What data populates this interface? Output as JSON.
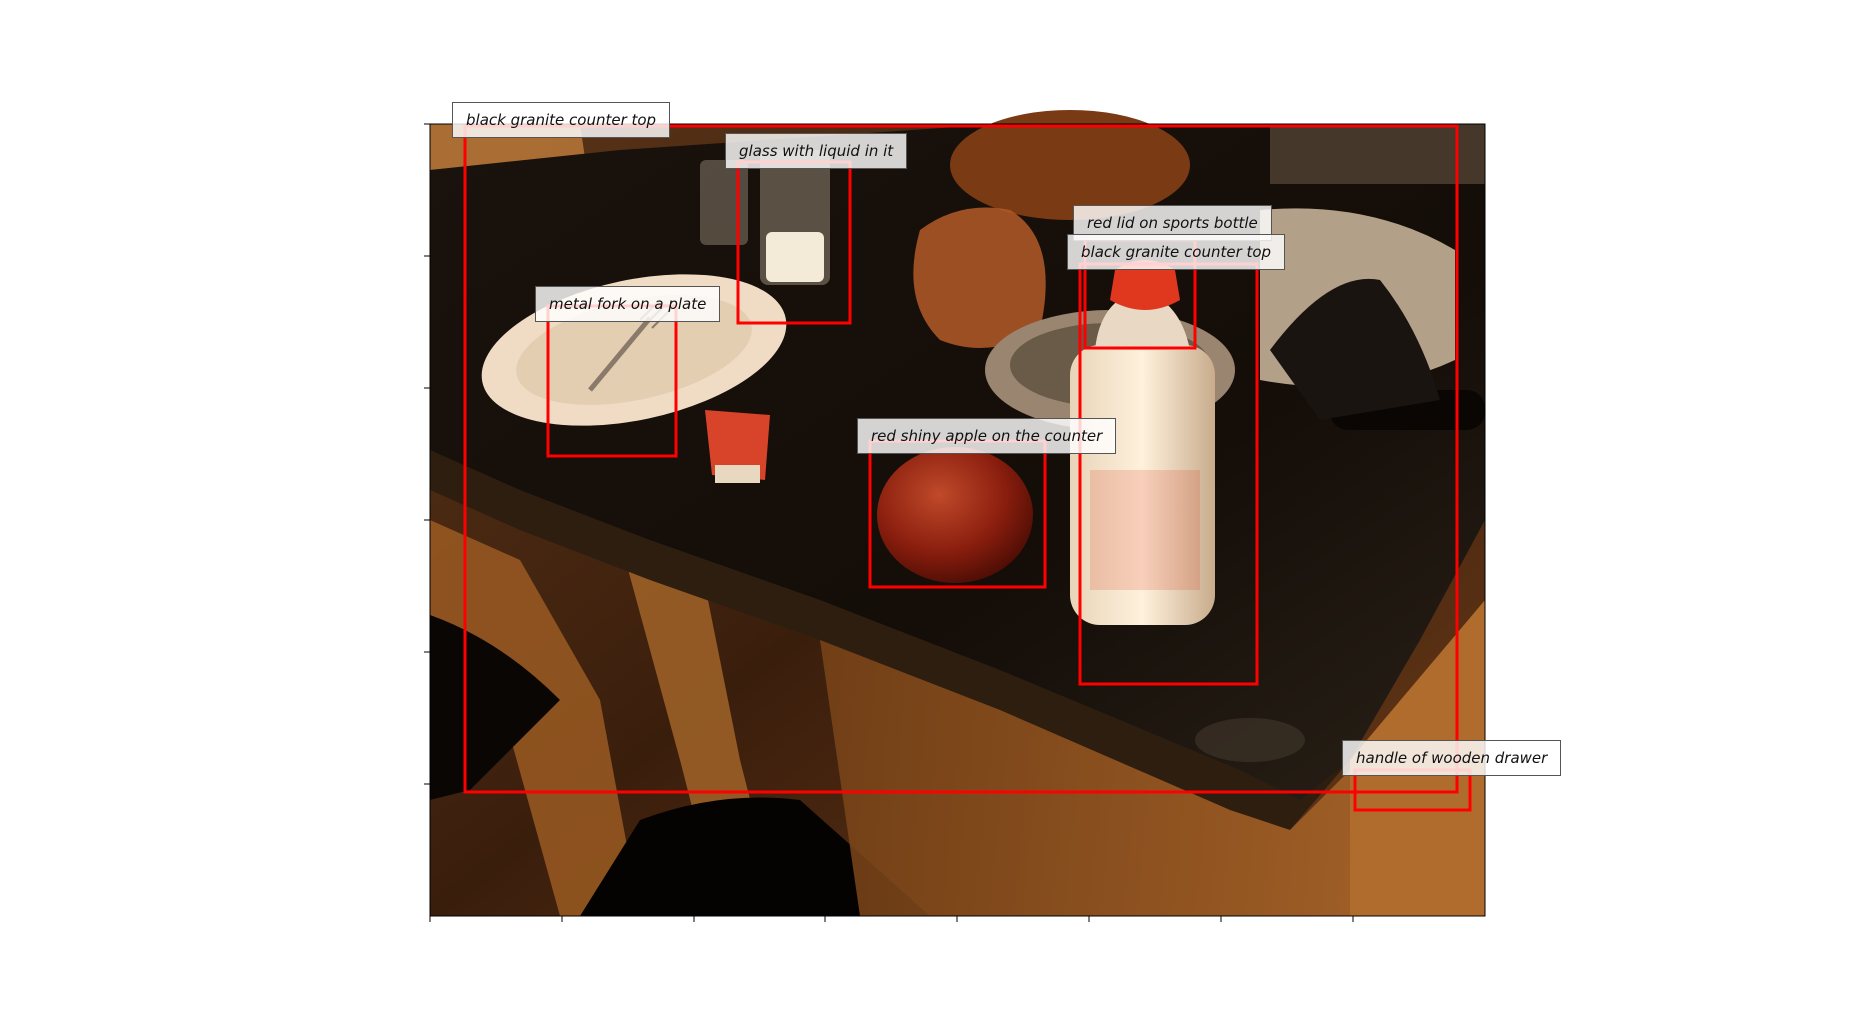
{
  "image": {
    "description_text": "",
    "annotation_color": "#ff0000"
  },
  "annotations": [
    {
      "label": "black granite counter top"
    },
    {
      "label": "glass with liquid in it"
    },
    {
      "label": "red lid on sports bottle"
    },
    {
      "label": "black granite counter top"
    },
    {
      "label": "metal fork on a plate"
    },
    {
      "label": "red shiny apple on the counter"
    },
    {
      "label": "handle of wooden drawer"
    }
  ]
}
